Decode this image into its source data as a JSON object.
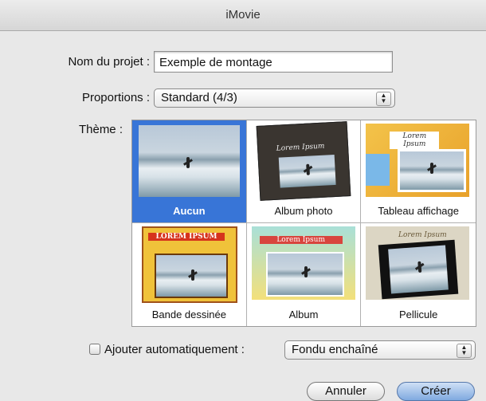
{
  "window": {
    "title": "iMovie"
  },
  "form": {
    "project_name_label": "Nom du projet :",
    "project_name_value": "Exemple de montage",
    "proportions_label": "Proportions :",
    "proportions_value": "Standard (4/3)",
    "theme_label": "Thème :"
  },
  "themes": [
    {
      "caption": "Aucun",
      "selected": true
    },
    {
      "caption": "Album photo",
      "selected": false,
      "text": "Lorem Ipsum"
    },
    {
      "caption": "Tableau affichage",
      "selected": false,
      "text": "Lorem Ipsum"
    },
    {
      "caption": "Bande dessinée",
      "selected": false,
      "text": "LOREM IPSUM"
    },
    {
      "caption": "Album",
      "selected": false,
      "text": "Lorem Ipsum"
    },
    {
      "caption": "Pellicule",
      "selected": false,
      "text": "Lorem Ipsum"
    }
  ],
  "auto": {
    "checkbox_label": "Ajouter automatiquement :",
    "checked": false,
    "transition_value": "Fondu enchaîné"
  },
  "buttons": {
    "cancel": "Annuler",
    "create": "Créer"
  },
  "icons": {
    "popup_arrows": "up-down-arrows-icon"
  },
  "colors": {
    "selection": "#3875d7"
  }
}
